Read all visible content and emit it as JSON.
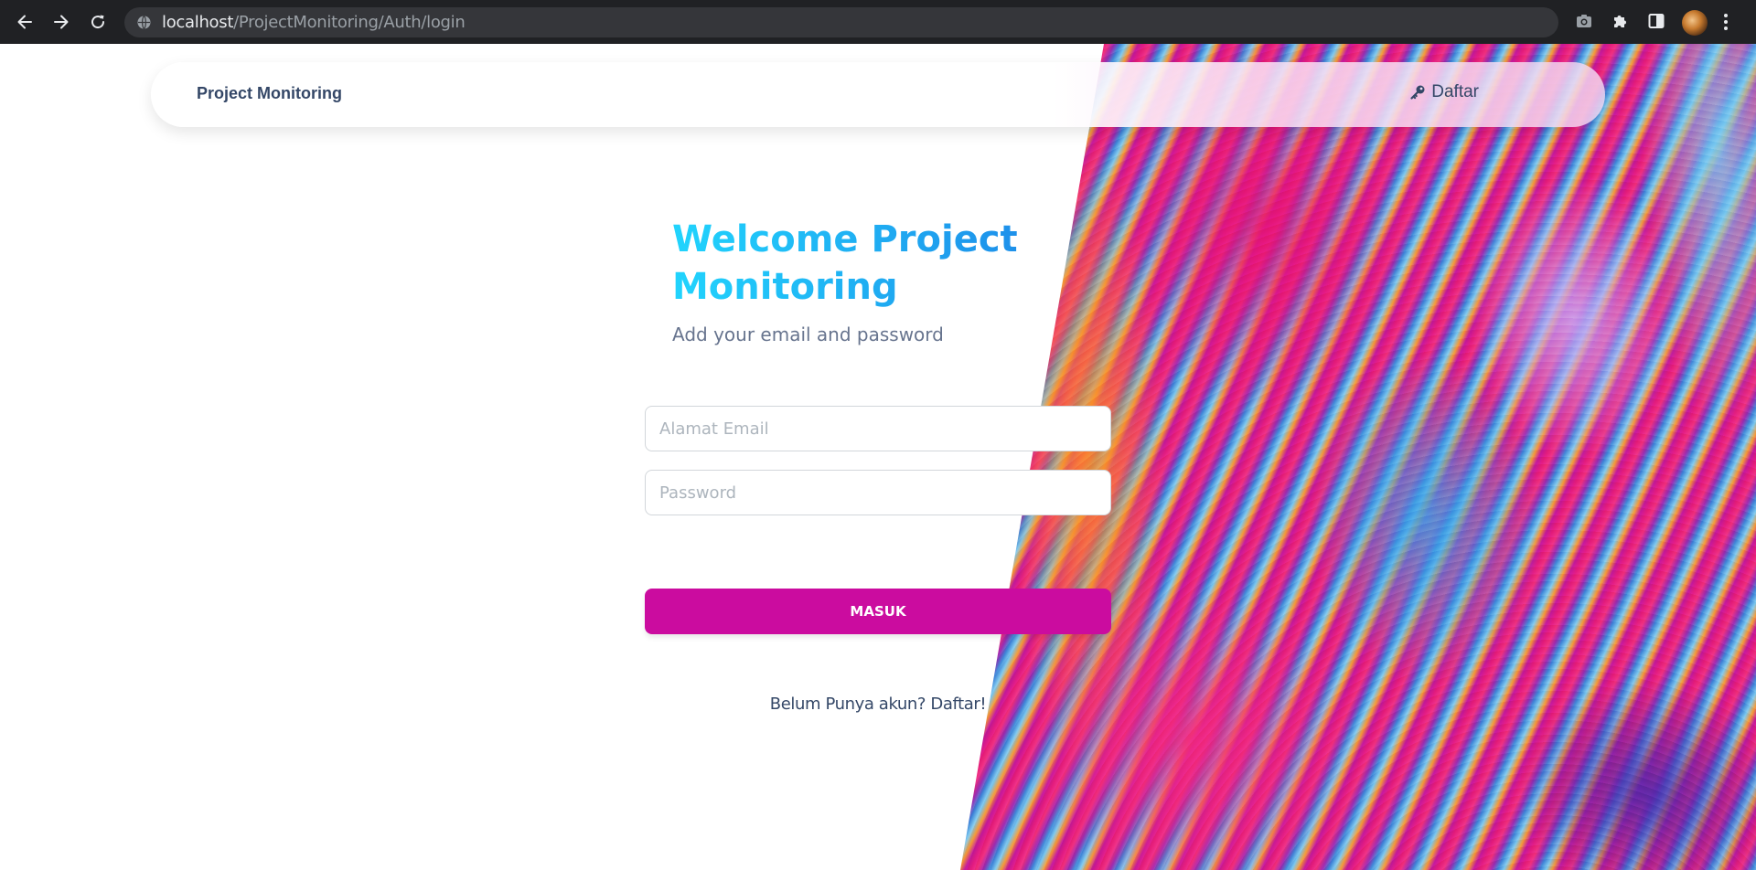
{
  "browser": {
    "url_host": "localhost",
    "url_path": "/ProjectMonitoring/Auth/login"
  },
  "navbar": {
    "brand": "Project Monitoring",
    "signup_link_label": "Daftar"
  },
  "login": {
    "title": "Welcome Project Monitoring",
    "subtitle": "Add your email and password",
    "email_placeholder": "Alamat Email",
    "password_placeholder": "Password",
    "submit_label": "MASUK",
    "register_text": "Belum Punya akun? Daftar!"
  },
  "colors": {
    "accent": "#cb0c9f",
    "title_gradient_start": "#21d4fd",
    "title_gradient_end": "#1e90ea",
    "text_dark": "#344767",
    "text_muted": "#67748e"
  },
  "icons": {
    "back": "arrow-left-icon",
    "forward": "arrow-right-icon",
    "reload": "reload-icon",
    "site_info": "site-info-icon",
    "screenshot": "camera-icon",
    "extensions": "puzzle-icon",
    "side_panel": "side-panel-icon",
    "menu": "kebab-menu-icon",
    "signup": "key-icon"
  }
}
